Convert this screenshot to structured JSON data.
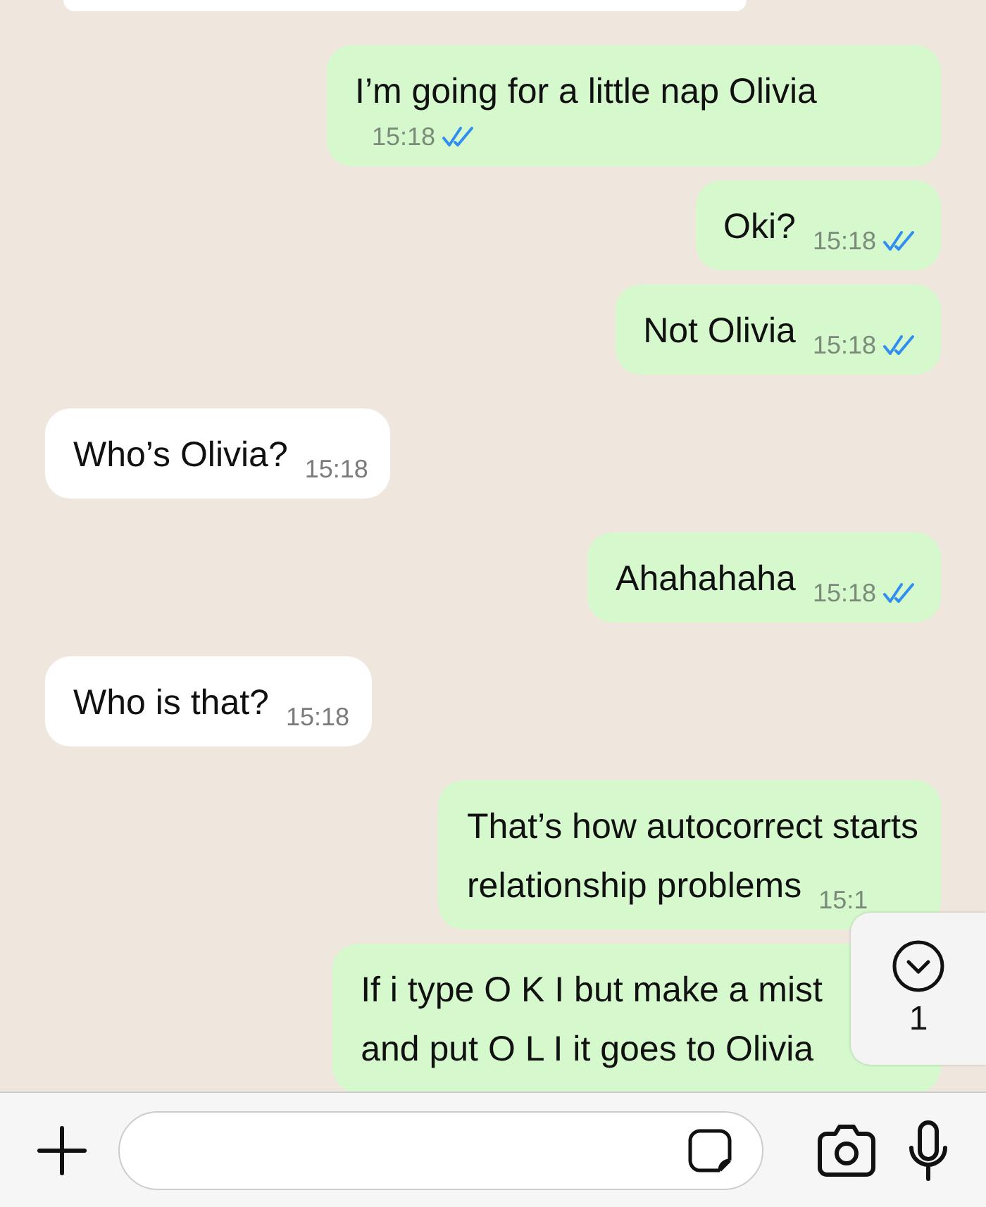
{
  "messages": [
    {
      "kind": "outgoing",
      "lines": [
        "I’m going for a little nap Olivia"
      ],
      "time": "15:18",
      "read": true
    },
    {
      "kind": "outgoing",
      "lines": [
        "Oki?"
      ],
      "time": "15:18",
      "read": true
    },
    {
      "kind": "outgoing",
      "lines": [
        "Not Olivia"
      ],
      "time": "15:18",
      "read": true
    },
    {
      "kind": "incoming",
      "lines": [
        "Who’s Olivia?"
      ],
      "time": "15:18"
    },
    {
      "kind": "outgoing",
      "lines": [
        "Ahahahaha"
      ],
      "time": "15:18",
      "read": true
    },
    {
      "kind": "incoming",
      "lines": [
        "Who is that?"
      ],
      "time": "15:18"
    },
    {
      "kind": "outgoing",
      "lines": [
        "That’s how autocorrect starts",
        "relationship problems"
      ],
      "time": "15:1"
    },
    {
      "kind": "outgoing",
      "lines": [
        "If i type O K I but make a mist",
        "and put O L I it goes to Olivia"
      ]
    }
  ],
  "scroll_down_button": {
    "count": "1"
  }
}
